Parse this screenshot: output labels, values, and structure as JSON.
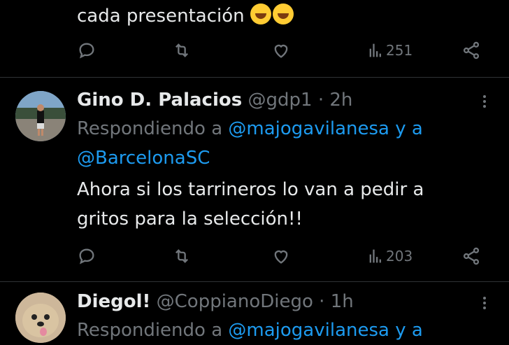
{
  "tweet0": {
    "text_tail": "cada presentación",
    "emoji": "rolling-on-floor-laughing-icon",
    "views": "251"
  },
  "reply1": {
    "name": "Gino D. Palacios",
    "handle": "@gdp1",
    "sep": "·",
    "time": "2h",
    "replying_prefix": "Respondiendo a",
    "replying_user1": "@majogavilanesa",
    "replying_and": "y a",
    "replying_user2": "@BarcelonaSC",
    "text_line1": "Ahora si los tarrineros lo van a pedir a",
    "text_line2": "gritos para la selección!!",
    "views": "203"
  },
  "reply2": {
    "name": "Diegol!",
    "handle": "@CoppianoDiego",
    "sep": "·",
    "time": "1h",
    "replying_prefix": "Respondiendo a",
    "replying_user1": "@majogavilanesa",
    "replying_and": "y a"
  },
  "colors": {
    "background": "#000000",
    "text": "#e7e9ea",
    "muted": "#71767b",
    "link": "#1d9bf0",
    "divider": "#2f3336"
  }
}
